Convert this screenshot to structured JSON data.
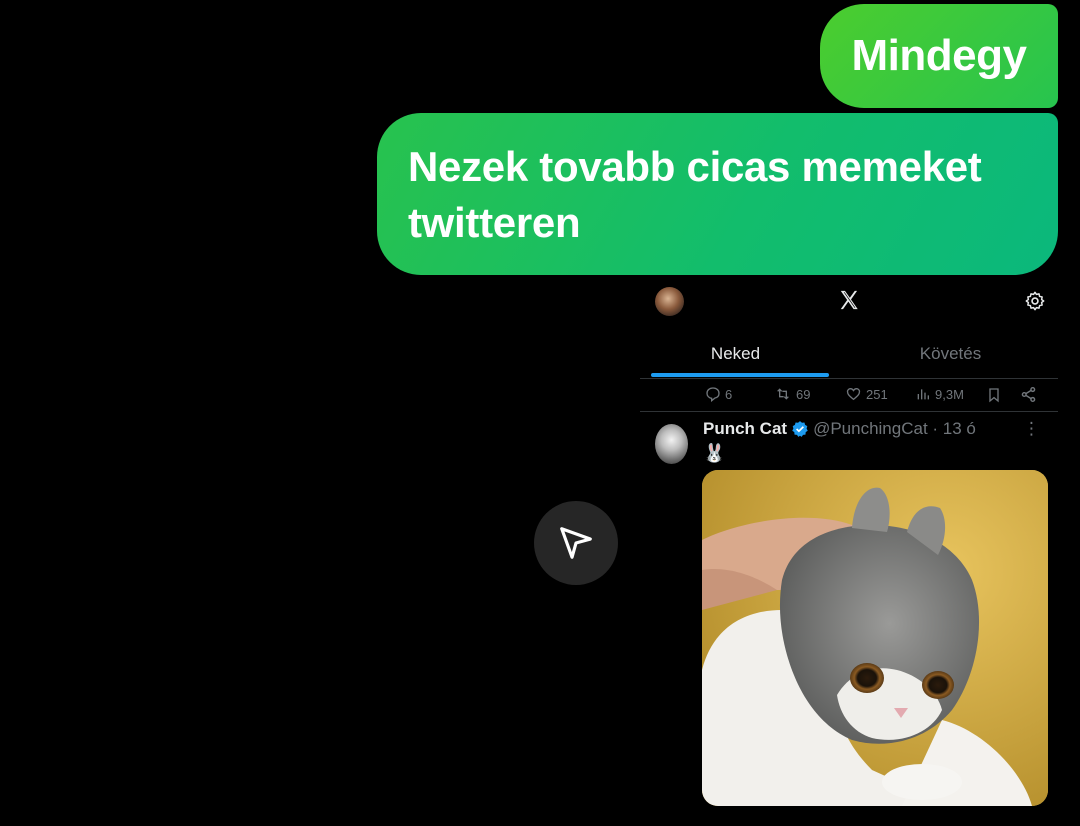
{
  "messages": [
    {
      "text": "Mindegy"
    },
    {
      "text": "Nezek tovabb cicas memeket twitteren"
    }
  ],
  "send_button_icon": "send-icon",
  "twitter": {
    "tabs": [
      {
        "label": "Neked",
        "active": true
      },
      {
        "label": "Követés",
        "active": false
      }
    ],
    "actions": {
      "replies": "6",
      "retweets": "69",
      "likes": "251",
      "views": "9,3M"
    },
    "post": {
      "name": "Punch Cat",
      "handle": "@PunchingCat · 13 ó",
      "emoji": "🐰",
      "more": "⋮"
    },
    "colors": {
      "accent": "#1d9bf0",
      "bubble_green": "#27c44f"
    }
  }
}
